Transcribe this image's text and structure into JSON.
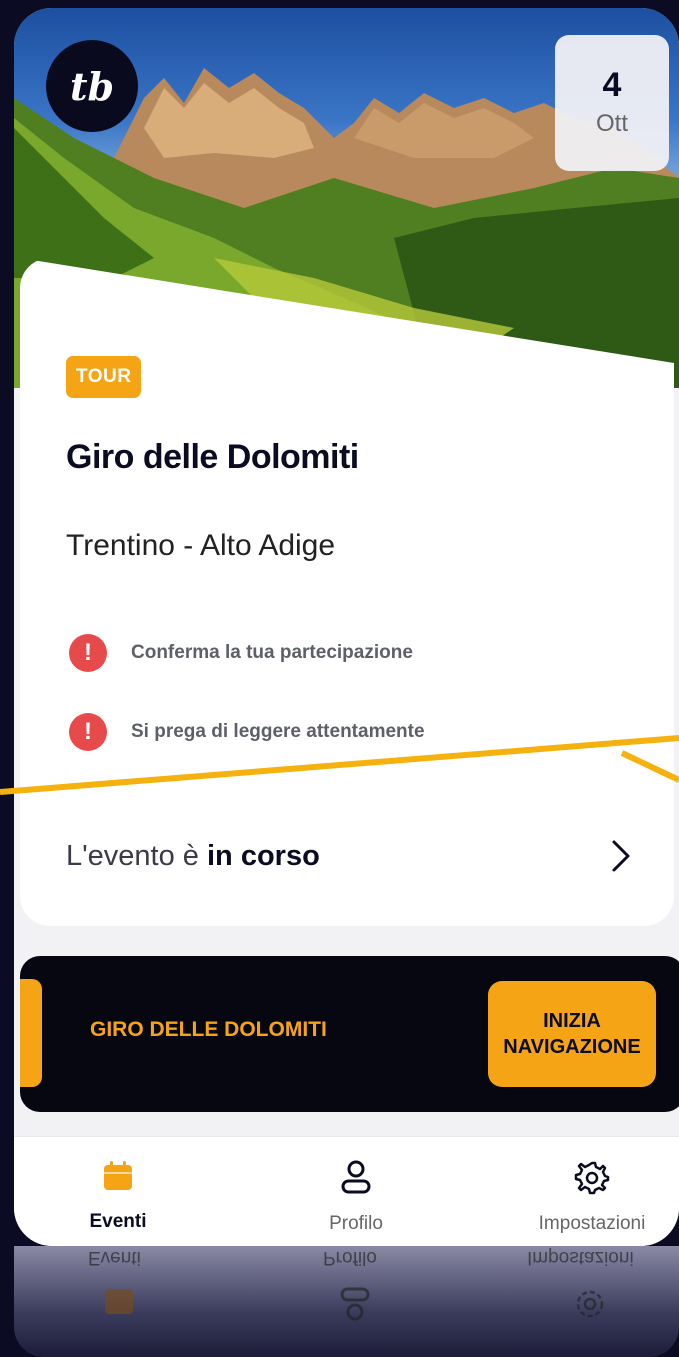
{
  "header": {
    "logo_text": "tb",
    "date_day": "4",
    "date_month": "Ott"
  },
  "event": {
    "tag": "TOUR",
    "title": "Giro delle Dolomiti",
    "location": "Trentino - Alto Adige",
    "alerts": [
      {
        "icon": "!",
        "text": "Conferma la tua partecipazione"
      },
      {
        "icon": "!",
        "text": "Si prega di leggere attentamente"
      }
    ],
    "status_prefix": "L'evento è",
    "status_value": "in corso"
  },
  "navigation_banner": {
    "title": "GIRO DELLE DOLOMITI",
    "button_line1": "INIZIA",
    "button_line2": "NAVIGAZIONE"
  },
  "tabbar": {
    "tabs": [
      {
        "label": "Eventi",
        "icon": "calendar-icon",
        "active": true
      },
      {
        "label": "Profilo",
        "icon": "user-icon",
        "active": false
      },
      {
        "label": "Impostazioni",
        "icon": "gear-icon",
        "active": false
      }
    ]
  },
  "colors": {
    "accent": "#f5a416",
    "dark": "#0b0b22",
    "alert": "#e74a4a"
  }
}
